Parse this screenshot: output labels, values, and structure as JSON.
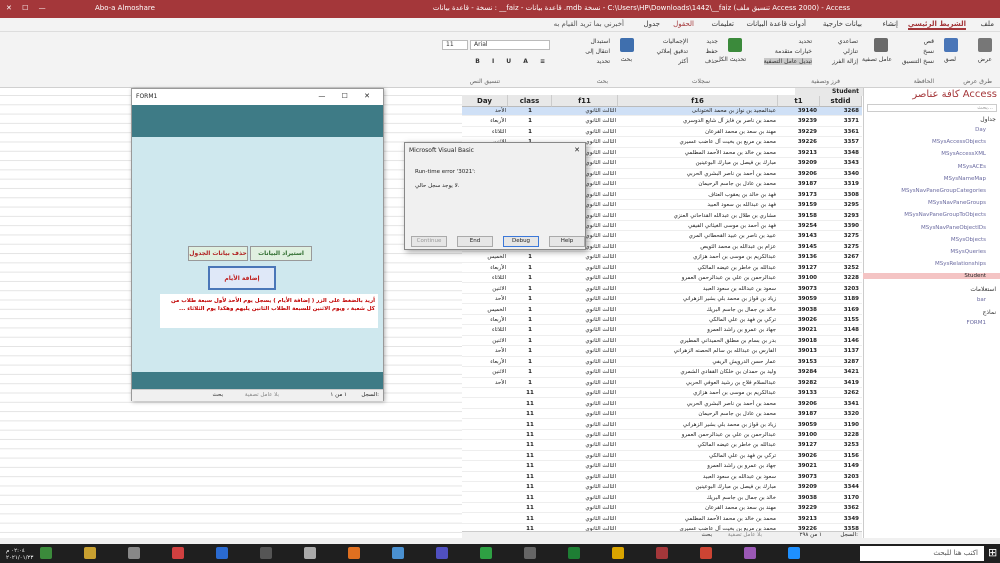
{
  "titlebar": {
    "user": "Abo-a Almoshare",
    "title": "Access - (Access 2000 تنسيق ملف) C:\\Users\\HP\\Downloads\\1442\\__faiz - نسخة mdb. قاعدة بيانات - faiz__ : نسخة - قاعدة بيانات"
  },
  "tabs": {
    "file": "ملف",
    "home": "الشريط الرئيسي",
    "create": "إنشاء",
    "external": "بيانات خارجية",
    "dbtools": "أدوات قاعدة البيانات",
    "help": "تعليمات",
    "fields": "الحقول",
    "table": "جدول",
    "tellme": "أخبرني بما تريد القيام به"
  },
  "ribbon": {
    "view": "عرض",
    "paste": "لصق",
    "cut": "قص",
    "copy": "نسخ",
    "format_painter": "نسخ التنسيق",
    "filter": "عامل تصفية",
    "ascending": "تصاعدي",
    "descending": "تنازلي",
    "remove_sort": "إزالة الفرز",
    "selection": "تحديد",
    "advanced": "خيارات متقدمة",
    "toggle_filter": "تبديل عامل التصفية",
    "refresh": "تحديث الكل",
    "new": "جديد",
    "save": "حفظ",
    "delete": "حذف",
    "totals": "الإجماليات",
    "spelling": "تدقيق إملائي",
    "more": "أكثر",
    "find": "بحث",
    "replace": "استبدال",
    "goto": "انتقال إلى",
    "select": "تحديد",
    "font": "Arial",
    "size": "11",
    "grp_views": "طرق عرض",
    "grp_clipboard": "الحافظة",
    "grp_sort": "فرز وتصفية",
    "grp_records": "سجلات",
    "grp_find": "بحث",
    "grp_text": "تنسيق النص"
  },
  "nav": {
    "title": "كافة عناصر Access",
    "search_placeholder": "بحث...",
    "tables_header": "جداول",
    "tables": [
      "Day",
      "MSysAccessObjects",
      "MSysAccessXML",
      "MSysACEs",
      "MSysNameMap",
      "MSysNavPaneGroupCategories",
      "MSysNavPaneGroups",
      "MSysNavPaneGroupToObjects",
      "MSysNavPaneObjectIDs",
      "MSysObjects",
      "MSysQueries",
      "MSysRelationships",
      "Student"
    ],
    "queries_header": "استعلامات",
    "queries": [
      "bar"
    ],
    "forms_header": "نماذج",
    "forms": [
      "FORM1"
    ]
  },
  "datasheet": {
    "tab": "Student",
    "headers": {
      "day": "Day",
      "cls": "class",
      "f11": "f11",
      "f16": "f16",
      "t1": "t1",
      "sid": "stdid"
    },
    "rows": [
      [
        "الأحد",
        "1",
        "الثالث الثانوي",
        "عبدالمجيد بن نواز بن محمد الختونانى",
        "39140",
        "3268"
      ],
      [
        "الأربعاء",
        "1",
        "الثالث الثانوي",
        "محمد بن ناصر بن فايز آل شايع الدوسري",
        "39239",
        "3371"
      ],
      [
        "الثلاثاء",
        "1",
        "الثالث الثانوي",
        "مهند بن سعد بن محمد القرعان",
        "39229",
        "3361"
      ],
      [
        "الاثنين",
        "1",
        "الثالث الثانوي",
        "محمد بن مربع بن بخيت آل عاضب عسيري",
        "39226",
        "3357"
      ],
      [
        "",
        "1",
        "الثالث الثانوي",
        "محمد بن خالد بن محمد الأحمد المطلمي",
        "39213",
        "3348"
      ],
      [
        "",
        "1",
        "الثالث الثانوي",
        "مبارك بن فيصل بن مبارك البوعينين",
        "39209",
        "3343"
      ],
      [
        "",
        "1",
        "الثالث الثانوي",
        "محمد بن أحمد بن ناصر البشري الحربي",
        "39206",
        "3340"
      ],
      [
        "",
        "1",
        "الثالث الثانوي",
        "محمد بن عادل بن جاسم الرحيمان",
        "39187",
        "3319"
      ],
      [
        "",
        "1",
        "الثالث الثانوي",
        "فهد بن خالد بن يعقوب العتاف",
        "39173",
        "3308"
      ],
      [
        "",
        "1",
        "الثالث الثانوي",
        "فهد بن عبدالله بن سعود العبيد",
        "39159",
        "3295"
      ],
      [
        "",
        "1",
        "الثالث الثانوي",
        "مشاري بن طلال بن عبدالله القداحاني العنزي",
        "39158",
        "3293"
      ],
      [
        "",
        "1",
        "الثالث الثانوي",
        "فهد بن أحمد بن موسى الغيثاني الفيفي",
        "39254",
        "3390"
      ],
      [
        "",
        "1",
        "الثالث الثانوي",
        "عبيد بن ناصر بن عبيد القحطاني المري",
        "39143",
        "3275"
      ],
      [
        "",
        "1",
        "الثالث الثانوي",
        "عزام بن عبدالله بن محمد الثويص",
        "39145",
        "3275"
      ],
      [
        "الخميس",
        "1",
        "الثالث الثانوي",
        "عبدالكريم بن موسى بن أحمد هزازي",
        "39136",
        "3267"
      ],
      [
        "الأربعاء",
        "1",
        "الثالث الثانوي",
        "عبدالله بن خاطر بن عيضه المالكي",
        "39127",
        "3252"
      ],
      [
        "الثلاثاء",
        "1",
        "الثالث الثانوي",
        "عبدالرحمن بن علي بن عبدالرحمن العمرو",
        "39100",
        "3228"
      ],
      [
        "الاثنين",
        "1",
        "الثالث الثانوي",
        "سعود بن عبدالله بن سعود العبيد",
        "39073",
        "3203"
      ],
      [
        "الأحد",
        "1",
        "الثالث الثانوي",
        "زياد بن قواز بن محمد بلي بشير الزهراني",
        "39059",
        "3189"
      ],
      [
        "الخميس",
        "1",
        "الثالث الثانوي",
        "خالد بن جمال بن جاسم البريك",
        "39038",
        "3169"
      ],
      [
        "الأربعاء",
        "1",
        "الثالث الثانوي",
        "تركي بن فهد بن علي المالكي",
        "39026",
        "3155"
      ],
      [
        "الثلاثاء",
        "1",
        "الثالث الثانوي",
        "جهاد بن عمرو بن راشد العمرو",
        "39021",
        "3148"
      ],
      [
        "الاثنين",
        "1",
        "الثالث الثانوي",
        "بدر بن بسام بن مطلق الحميداني المطيري",
        "39018",
        "3146"
      ],
      [
        "الأحد",
        "1",
        "الثالث الثانوي",
        "الفارس بن عبدالله بن سالم الحصنه الزهراني",
        "39013",
        "3137"
      ],
      [
        "الأربعاء",
        "1",
        "الثالث الثانوي",
        "عمار حسن الدرويش الريفي",
        "39153",
        "3287"
      ],
      [
        "الاثنين",
        "1",
        "الثالث الثانوي",
        "وليد بن حمدان بن خلكان القفادي الشمري",
        "39284",
        "3421"
      ],
      [
        "الأحد",
        "1",
        "الثالث الثانوي",
        "عبدالسلام فلاح بن رشيد العوفي الحربي",
        "39282",
        "3419"
      ],
      [
        "",
        "11",
        "الثالث الثانوي",
        "عبدالكريم بن موسى بن أحمد هزازي",
        "39133",
        "3262"
      ],
      [
        "",
        "11",
        "الثالث الثانوي",
        "محمد بن أحمد بن ناصر البشري الحربي",
        "39206",
        "3341"
      ],
      [
        "",
        "11",
        "الثالث الثانوي",
        "محمد بن عادل بن جاسم الرحيمان",
        "39187",
        "3320"
      ],
      [
        "",
        "11",
        "الثالث الثانوي",
        "زياد بن قواز بن محمد بلي بشير الزهراني",
        "39059",
        "3190"
      ],
      [
        "",
        "11",
        "الثالث الثانوي",
        "عبدالرحمن بن علي بن عبدالرحمن العمرو",
        "39100",
        "3228"
      ],
      [
        "",
        "11",
        "الثالث الثانوي",
        "عبدالله بن خاطر بن عيضه المالكي",
        "39127",
        "3253"
      ],
      [
        "",
        "11",
        "الثالث الثانوي",
        "تركي بن فهد بن علي المالكي",
        "39026",
        "3156"
      ],
      [
        "",
        "11",
        "الثالث الثانوي",
        "جهاد بن عمرو بن راشد العمرو",
        "39021",
        "3149"
      ],
      [
        "",
        "11",
        "الثالث الثانوي",
        "سعود بن عبدالله بن سعود العبيد",
        "39073",
        "3203"
      ],
      [
        "",
        "11",
        "الثالث الثانوي",
        "مبارك بن فيصل بن مبارك البوعينين",
        "39209",
        "3344"
      ],
      [
        "",
        "11",
        "الثالث الثانوي",
        "خالد بن جمال بن جاسم البريك",
        "39038",
        "3170"
      ],
      [
        "",
        "11",
        "الثالث الثانوي",
        "مهند بن سعد بن محمد القرعان",
        "39229",
        "3362"
      ],
      [
        "",
        "11",
        "الثالث الثانوي",
        "محمد بن خالد بن محمد الأحمد المطلمي",
        "39213",
        "3349"
      ],
      [
        "",
        "11",
        "الثالث الثانوي",
        "محمد بن مربع بن بخيت آل عاضب عسيري",
        "39226",
        "3358"
      ]
    ],
    "record_label": "السجل:",
    "record_pos": "١ من ٢٩٨",
    "no_filter": "بلا عامل تصفية",
    "search": "بحث"
  },
  "form1": {
    "title": "FORM1",
    "btn_import": "استيراد البيانات",
    "btn_delete": "حذف بيانات الجدول",
    "btn_add_days": "إضافة الأيام",
    "note": "أريد بالضغط على الزر ( إضافة الأيام ) يسجل يوم الأحد لأول سبعة طلاب من كل شعبة ، ويوم الاثنين للسبعة الطلاب الثانين يليهم وهكذا يوم الثلاثاء ...",
    "record_label": "السجل:",
    "record_pos": "١ من ١",
    "no_filter": "بلا عامل تصفية",
    "search": "بحث"
  },
  "msgbox": {
    "title": "Microsoft Visual Basic",
    "error": "Run-time error '3021':",
    "message": "لا يوجد سجل حالي.",
    "continue": "Continue",
    "end": "End",
    "debug": "Debug",
    "help": "Help"
  },
  "taskbar": {
    "search": "اكتب هنا للبحث",
    "time": "٠٢:٠٤ م",
    "date": "٢٠٢١/٠١/٢٣"
  }
}
